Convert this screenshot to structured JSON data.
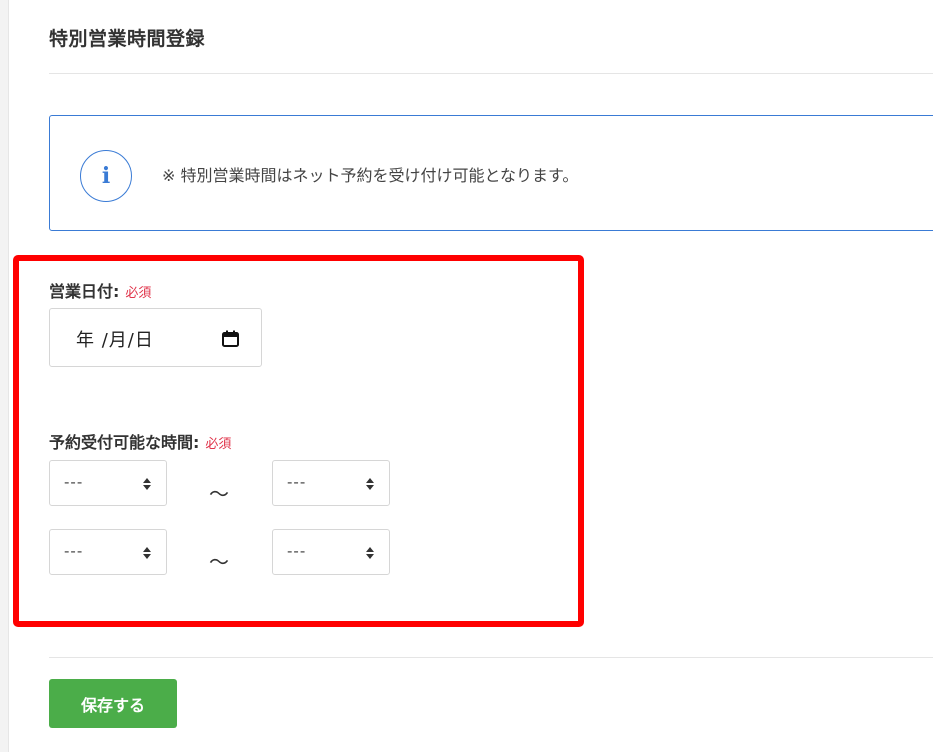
{
  "page": {
    "title": "特別営業時間登録"
  },
  "info": {
    "icon": "info-icon",
    "message": "※ 特別営業時間はネット予約を受け付け可能となります。"
  },
  "form": {
    "date_label": "営業日付:",
    "date_required": "必須",
    "date_value": "年 /月/日",
    "time_label": "予約受付可能な時間:",
    "time_required": "必須",
    "separator": "～",
    "rows": [
      {
        "start": "---",
        "end": "---"
      },
      {
        "start": "---",
        "end": "---"
      }
    ]
  },
  "actions": {
    "save_label": "保存する"
  },
  "colors": {
    "accent_blue": "#3a7bd5",
    "required_red": "#e0334a",
    "highlight_red": "#ff0000",
    "save_green": "#4bad49"
  }
}
